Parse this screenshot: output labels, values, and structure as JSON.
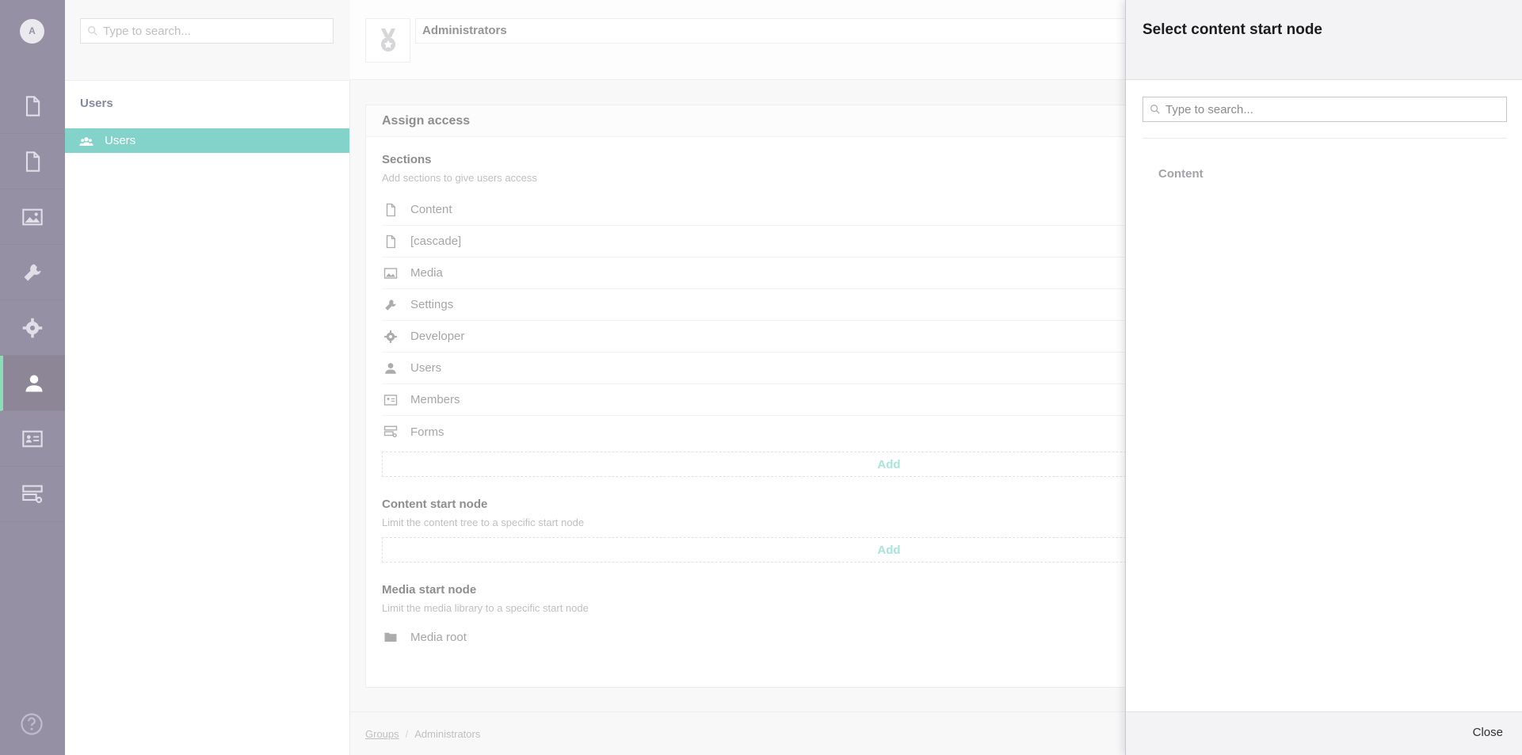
{
  "appbar": {
    "avatar_initial": "A",
    "items": [
      {
        "name": "content-section",
        "icon": "document-icon"
      },
      {
        "name": "cascade-section",
        "icon": "document-icon"
      },
      {
        "name": "media-section",
        "icon": "image-icon"
      },
      {
        "name": "settings-section",
        "icon": "wrench-icon"
      },
      {
        "name": "developer-section",
        "icon": "gear-icon"
      },
      {
        "name": "users-section",
        "icon": "user-icon",
        "active": true
      },
      {
        "name": "members-section",
        "icon": "id-card-icon"
      },
      {
        "name": "forms-section",
        "icon": "forms-icon"
      }
    ],
    "help_icon": "question-icon"
  },
  "tree": {
    "search_placeholder": "Type to search...",
    "title": "Users",
    "node_label": "Users"
  },
  "editor": {
    "group_name": "Administrators",
    "panel_title": "Assign access",
    "sections": {
      "label": "Sections",
      "description": "Add sections to give users access",
      "items": [
        "Content",
        "[cascade]",
        "Media",
        "Settings",
        "Developer",
        "Users",
        "Members",
        "Forms"
      ],
      "add_label": "Add"
    },
    "content_start": {
      "label": "Content start node",
      "description": "Limit the content tree to a specific start node",
      "add_label": "Add"
    },
    "media_start": {
      "label": "Media start node",
      "description": "Limit the media library to a specific start node",
      "item": "Media root"
    },
    "breadcrumb": {
      "groups": "Groups",
      "current": "Administrators"
    }
  },
  "dialog": {
    "title": "Select content start node",
    "search_placeholder": "Type to search...",
    "item": "Content",
    "close_label": "Close"
  },
  "colors": {
    "appbar": "#413659",
    "accent": "#1fb0a0",
    "add_text": "#5dcfb6"
  }
}
